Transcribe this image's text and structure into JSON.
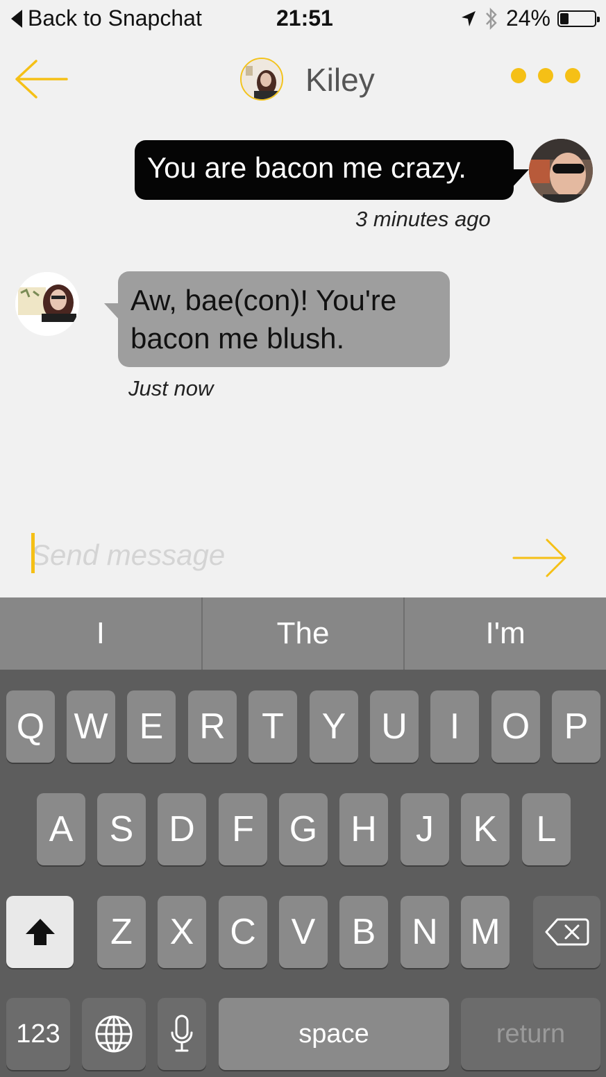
{
  "status_bar": {
    "back_label": "Back to Snapchat",
    "time": "21:51",
    "battery": "24%",
    "battery_level": 0.24
  },
  "header": {
    "contact_name": "Kiley",
    "back_icon": "arrow-left-icon",
    "more_icon": "more-dots-icon"
  },
  "messages": [
    {
      "direction": "outgoing",
      "text": "You are bacon me crazy.",
      "time": "3 minutes ago"
    },
    {
      "direction": "incoming",
      "text": "Aw, bae(con)! You're bacon me blush.",
      "time": "Just now"
    }
  ],
  "composer": {
    "placeholder": "Send message",
    "send_icon": "arrow-right-icon"
  },
  "keyboard": {
    "suggestions": [
      "I",
      "The",
      "I'm"
    ],
    "row1": [
      "Q",
      "W",
      "E",
      "R",
      "T",
      "Y",
      "U",
      "I",
      "O",
      "P"
    ],
    "row2": [
      "A",
      "S",
      "D",
      "F",
      "G",
      "H",
      "J",
      "K",
      "L"
    ],
    "row3": [
      "Z",
      "X",
      "C",
      "V",
      "B",
      "N",
      "M"
    ],
    "numbers_label": "123",
    "space_label": "space",
    "return_label": "return"
  },
  "colors": {
    "accent": "#f5c016",
    "outgoing_bubble": "#050505",
    "incoming_bubble": "#9e9e9e",
    "background": "#f1f1f1",
    "keyboard": "#5d5d5d"
  }
}
